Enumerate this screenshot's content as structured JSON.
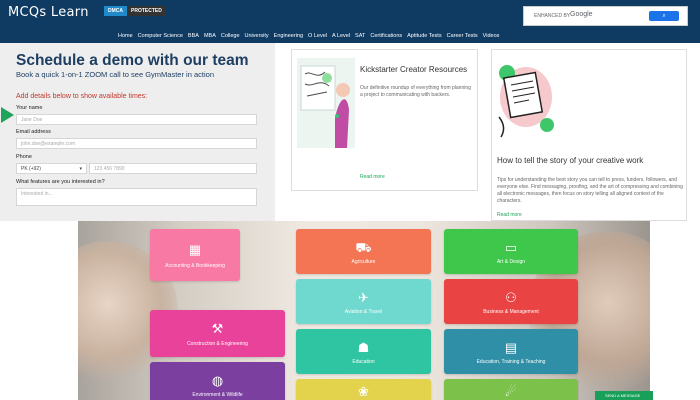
{
  "header": {
    "logo": "MCQs Learn",
    "dmca": "DMCA",
    "protected": "PROTECTED",
    "search_placeholder": "ENHANCED BY",
    "search_brand": "Google",
    "nav": [
      "Home",
      "Computer Science",
      "BBA",
      "MBA",
      "College",
      "University",
      "Engineering",
      "O Level",
      "A Level",
      "SAT",
      "Certifications",
      "Aptitude Tests",
      "Career Tests",
      "Videos"
    ]
  },
  "demo": {
    "title": "Schedule a demo with our team",
    "subtitle": "Book a quick 1-on-1 ZOOM call to see GymMaster in action",
    "prompt": "Add details below to show available times:",
    "name_label": "Your name",
    "name_placeholder": "Jane Doe",
    "email_label": "Email address",
    "email_placeholder": "john.doe@example.com",
    "phone_label": "Phone",
    "phone_code": "PK (+92)",
    "phone_placeholder": "123 456 7890",
    "features_label": "What features are you interested in?",
    "features_placeholder": "Interested in..."
  },
  "card1": {
    "title": "Kickstarter Creator Resources",
    "text": "Our definitive roundup of everything from planning a project to communicating with backers.",
    "link": "Read more"
  },
  "card2": {
    "title": "How to tell the story of your creative work",
    "text": "Tips for understanding the best story you can tell to press, funders, followers, and everyone else. Find messaging, proofing, and the art of compressing and combining all electronic messages, then focus on story telling all aligned context of the characters.",
    "link": "Read more"
  },
  "categories": [
    {
      "label": "Accounting & Bookkeeping",
      "icon": "calculator-icon",
      "glyph": "▦",
      "color": "#f87aa4"
    },
    {
      "label": "Agriculture",
      "icon": "tractor-icon",
      "glyph": "⛟",
      "color": "#f37553"
    },
    {
      "label": "Art & Design",
      "icon": "monitor-icon",
      "glyph": "▭",
      "color": "#3ec74a"
    },
    {
      "label": "Aviation & Travel",
      "icon": "airplane-icon",
      "glyph": "✈",
      "color": "#6fd9cf"
    },
    {
      "label": "Business & Management",
      "icon": "people-icon",
      "glyph": "⚇",
      "color": "#e94343"
    },
    {
      "label": "Construction & Engineering",
      "icon": "hammer-icon",
      "glyph": "⚒",
      "color": "#e8429a"
    },
    {
      "label": "Education",
      "icon": "graduation-icon",
      "glyph": "☗",
      "color": "#2fc4a2"
    },
    {
      "label": "Education, Training & Teaching",
      "icon": "book-icon",
      "glyph": "▤",
      "color": "#2e8fa6"
    },
    {
      "label": "Environment & Wildlife",
      "icon": "globe-icon",
      "glyph": "◍",
      "color": "#7b3fa0"
    },
    {
      "label": "",
      "icon": "leaf-icon",
      "glyph": "❀",
      "color": "#e3d34c"
    },
    {
      "label": "",
      "icon": "running-icon",
      "glyph": "☄",
      "color": "#7cc24a"
    }
  ],
  "contact_badge": "SEND A MESSAGE"
}
